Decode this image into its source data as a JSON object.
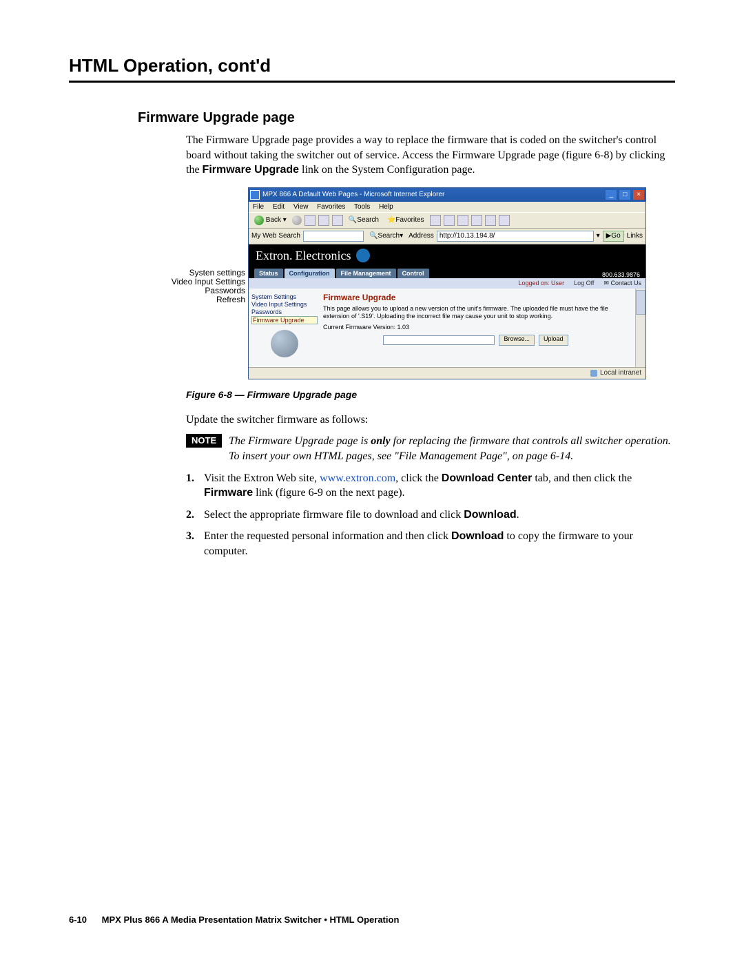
{
  "chapter_title": "HTML Operation, cont'd",
  "section_title": "Firmware Upgrade page",
  "intro_para": "The Firmware Upgrade page provides a way to replace the firmware that is coded on the switcher's control board without taking the switcher out of service. Access the Firmware Upgrade page (figure 6-8) by clicking the ",
  "intro_bold": "Firmware Upgrade",
  "intro_tail": " link on the System Configuration page.",
  "callouts": {
    "c1": "Systen settings",
    "c2": "Video Input Settings",
    "c3": "Passwords",
    "c4": "Refresh"
  },
  "browser": {
    "title": "MPX 866 A Default Web Pages - Microsoft Internet Explorer",
    "menu": {
      "file": "File",
      "edit": "Edit",
      "view": "View",
      "fav": "Favorites",
      "tools": "Tools",
      "help": "Help"
    },
    "back": "Back",
    "search": "Search",
    "favorites": "Favorites",
    "mywebsearch": "My Web Search",
    "psearch": "Search",
    "address_label": "Address",
    "address_value": "http://10.13.194.8/",
    "go": "Go",
    "links": "Links"
  },
  "brand": {
    "name": "Extron",
    "sub": "Electronics"
  },
  "tabs": [
    "Status",
    "Configuration",
    "File Management",
    "Control"
  ],
  "phone": "800.633.9876",
  "logged": "Logged on: User",
  "logoff": "Log Off",
  "contact": "Contact Us",
  "sidebar": {
    "items": [
      "System Settings",
      "Video Input Settings",
      "Passwords",
      "Firmware Upgrade"
    ]
  },
  "panel": {
    "title": "Firmware Upgrade",
    "text": "This page allows you to upload a new version of the unit's firmware. The uploaded file must have the file extension of '.S19'. Uploading the incorrect file may cause your unit to stop working.",
    "ver_label": "Current Firmware Version: 1.03",
    "browse": "Browse...",
    "upload": "Upload"
  },
  "status_zone": "Local intranet",
  "figure_caption": "Figure 6-8 — Firmware Upgrade page",
  "update_line": "Update the switcher firmware as follows:",
  "note_label": "NOTE",
  "note_pre": "The Firmware Upgrade page is ",
  "note_only": "only",
  "note_post": " for replacing the firmware that controls all switcher operation. To insert your own HTML pages, see \"File Management Page\", on page 6-14.",
  "steps": {
    "s1_num": "1",
    "s1_a": "Visit the Extron Web site, ",
    "s1_link": "www.extron.com",
    "s1_b": ", click the ",
    "s1_bold1": "Download Center",
    "s1_c": " tab, and then click the ",
    "s1_bold2": "Firmware",
    "s1_d": " link (figure 6-9 on the next page).",
    "s2_num": "2",
    "s2_a": "Select the appropriate firmware file to download and click ",
    "s2_bold": "Download",
    "s2_b": ".",
    "s3_num": "3",
    "s3_a": "Enter the requested personal information and then click ",
    "s3_bold": "Download",
    "s3_b": " to copy the firmware to your computer."
  },
  "footer": {
    "page": "6-10",
    "text": "MPX Plus 866 A Media Presentation Matrix Switcher • HTML Operation"
  }
}
